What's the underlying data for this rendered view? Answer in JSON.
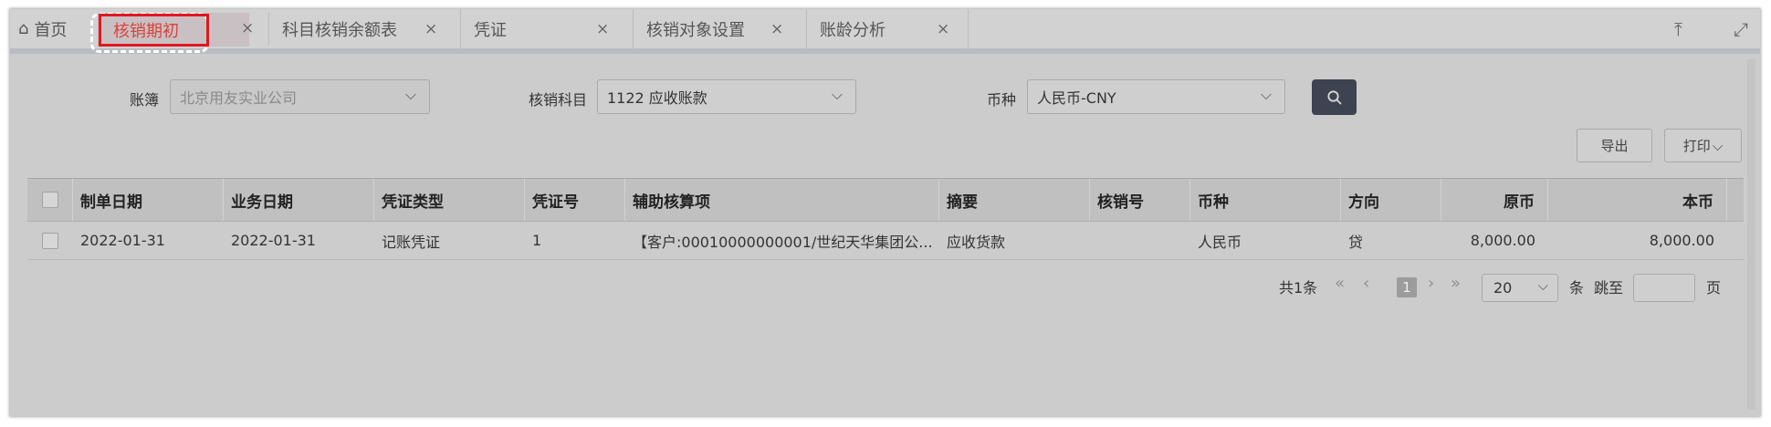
{
  "tabs": {
    "home": "首页",
    "active": "核销期初",
    "items": [
      "科目核销余额表",
      "凭证",
      "核销对象设置",
      "账龄分析"
    ],
    "close_glyph": "×"
  },
  "filters": {
    "book_label": "账簿",
    "book_value": "北京用友实业公司",
    "subject_label": "核销科目",
    "subject_value": "1122 应收账款",
    "currency_label": "币种",
    "currency_value": "人民币-CNY"
  },
  "actions": {
    "export": "导出",
    "print": "打印"
  },
  "table": {
    "headers": [
      "制单日期",
      "业务日期",
      "凭证类型",
      "凭证号",
      "辅助核算项",
      "摘要",
      "核销号",
      "币种",
      "方向",
      "原币",
      "本币"
    ],
    "rows": [
      [
        "2022-01-31",
        "2022-01-31",
        "记账凭证",
        "1",
        "【客户:00010000000001/世纪天华集团公...",
        "应收货款",
        "",
        "人民币",
        "贷",
        "8,000.00",
        "8,000.00"
      ]
    ]
  },
  "pagination": {
    "total": "共1条",
    "current_page": "1",
    "page_size": "20",
    "unit": "条",
    "jump_label": "跳至",
    "page_suffix": "页"
  },
  "colors": {
    "active_tab_border": "#e0171f",
    "active_tab_text": "#d9423b",
    "search_button": "#3d4350"
  }
}
